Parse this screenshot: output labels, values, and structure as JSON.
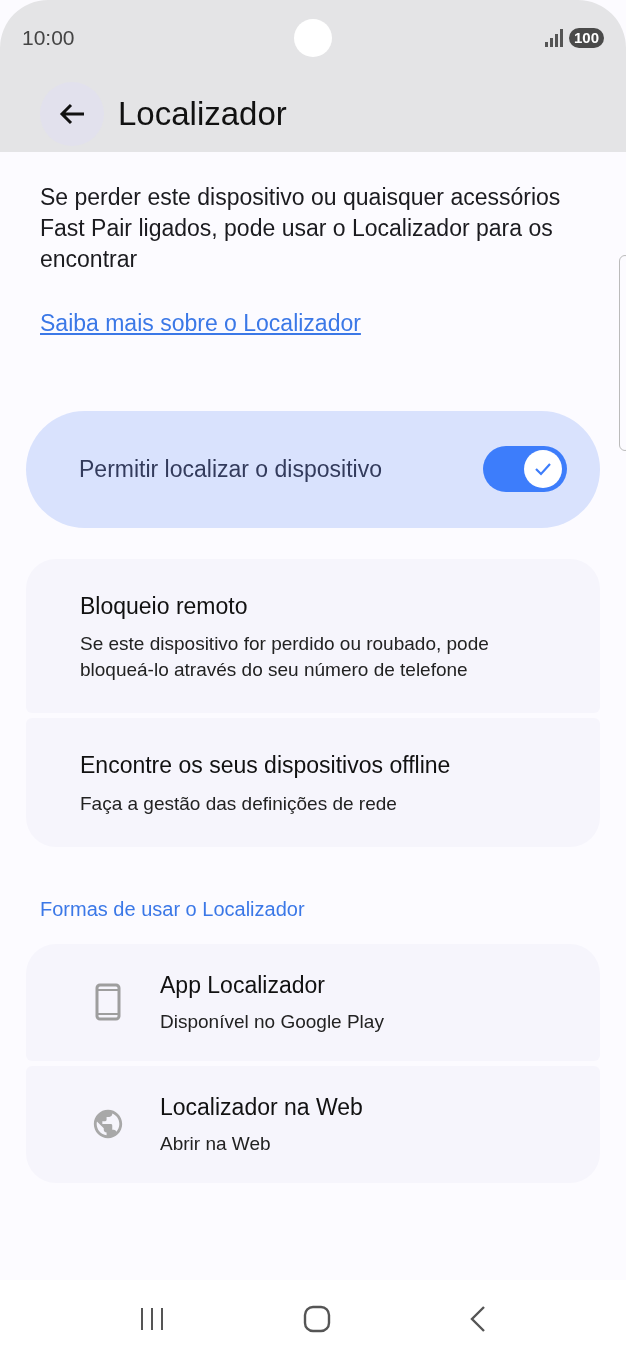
{
  "status_bar": {
    "time": "10:00",
    "battery": "100"
  },
  "app_bar": {
    "title": "Localizador"
  },
  "description": "Se perder este dispositivo ou quaisquer acessórios Fast Pair ligados, pode usar o Localizador para os encontrar",
  "learn_more_link": "Saiba mais sobre o Localizador",
  "main_switch": {
    "label": "Permitir localizar o dispositivo",
    "on": true
  },
  "settings": [
    {
      "title": "Bloqueio remoto",
      "subtitle": "Se este dispositivo for perdido ou roubado, pode bloqueá-lo através do seu número de telefone"
    },
    {
      "title": "Encontre os seus dispositivos offline",
      "subtitle": "Faça a gestão das definições de rede"
    }
  ],
  "section_header": "Formas de usar o Localizador",
  "ways": [
    {
      "kind": "phone",
      "title": "App Localizador",
      "subtitle": "Disponível no Google Play"
    },
    {
      "kind": "globe",
      "title": "Localizador na Web",
      "subtitle": "Abrir na Web"
    }
  ]
}
